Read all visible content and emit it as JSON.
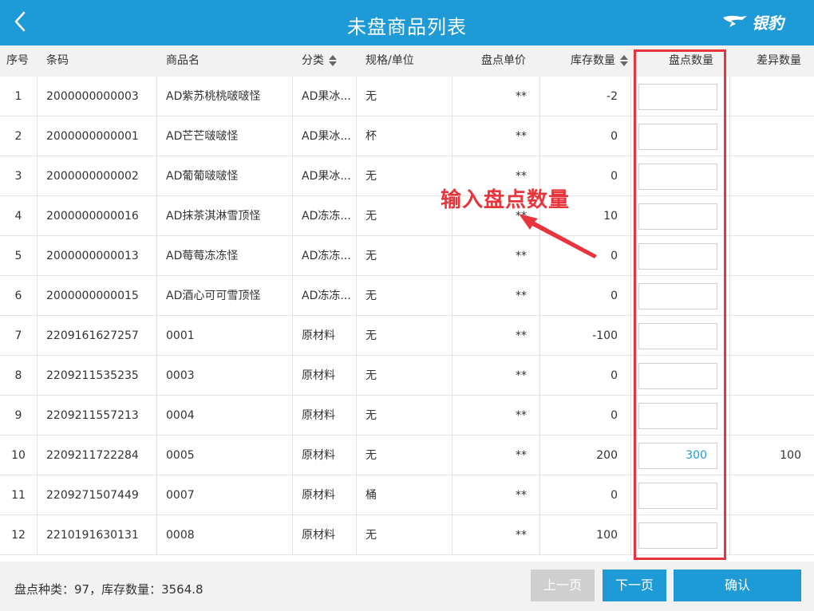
{
  "header": {
    "title": "未盘商品列表",
    "logo_text": "银豹",
    "back_icon": "chevron-left-icon"
  },
  "columns": [
    "序号",
    "条码",
    "商品名",
    "分类",
    "规格/单位",
    "盘点单价",
    "库存数量",
    "盘点数量",
    "差异数量"
  ],
  "rows": [
    {
      "no": "1",
      "barcode": "2000000000003",
      "name": "AD紫苏桃桃啵啵怪",
      "category": "AD果冰...",
      "spec": "无",
      "price": "**",
      "stock": "-2",
      "count": "",
      "diff": ""
    },
    {
      "no": "2",
      "barcode": "2000000000001",
      "name": "AD芒芒啵啵怪",
      "category": "AD果冰...",
      "spec": "杯",
      "price": "**",
      "stock": "0",
      "count": "",
      "diff": ""
    },
    {
      "no": "3",
      "barcode": "2000000000002",
      "name": "AD葡葡啵啵怪",
      "category": "AD果冰...",
      "spec": "无",
      "price": "**",
      "stock": "0",
      "count": "",
      "diff": ""
    },
    {
      "no": "4",
      "barcode": "2000000000016",
      "name": "AD抹茶淇淋雪顶怪",
      "category": "AD冻冻...",
      "spec": "无",
      "price": "**",
      "stock": "10",
      "count": "",
      "diff": ""
    },
    {
      "no": "5",
      "barcode": "2000000000013",
      "name": "AD莓莓冻冻怪",
      "category": "AD冻冻...",
      "spec": "无",
      "price": "**",
      "stock": "0",
      "count": "",
      "diff": ""
    },
    {
      "no": "6",
      "barcode": "2000000000015",
      "name": "AD酒心可可雪顶怪",
      "category": "AD冻冻...",
      "spec": "无",
      "price": "**",
      "stock": "0",
      "count": "",
      "diff": ""
    },
    {
      "no": "7",
      "barcode": "2209161627257",
      "name": "0001",
      "category": "原材料",
      "spec": "无",
      "price": "**",
      "stock": "-100",
      "count": "",
      "diff": ""
    },
    {
      "no": "8",
      "barcode": "2209211535235",
      "name": "0003",
      "category": "原材料",
      "spec": "无",
      "price": "**",
      "stock": "0",
      "count": "",
      "diff": ""
    },
    {
      "no": "9",
      "barcode": "2209211557213",
      "name": "0004",
      "category": "原材料",
      "spec": "无",
      "price": "**",
      "stock": "0",
      "count": "",
      "diff": ""
    },
    {
      "no": "10",
      "barcode": "2209211722284",
      "name": "0005",
      "category": "原材料",
      "spec": "无",
      "price": "**",
      "stock": "200",
      "count": "300",
      "diff": "100"
    },
    {
      "no": "11",
      "barcode": "2209271507449",
      "name": "0007",
      "category": "原材料",
      "spec": "桶",
      "price": "**",
      "stock": "0",
      "count": "",
      "diff": ""
    },
    {
      "no": "12",
      "barcode": "2210191630131",
      "name": "0008",
      "category": "原材料",
      "spec": "无",
      "price": "**",
      "stock": "100",
      "count": "",
      "diff": ""
    }
  ],
  "annotation": "输入盘点数量",
  "footer": {
    "summary": "盘点种类：97，库存数量：3564.8",
    "prev_label": "上一页",
    "next_label": "下一页",
    "confirm_label": "确认"
  },
  "colors": {
    "primary": "#1e9ad6",
    "highlight": "#e8343a",
    "disabled": "#cfcfcf"
  }
}
